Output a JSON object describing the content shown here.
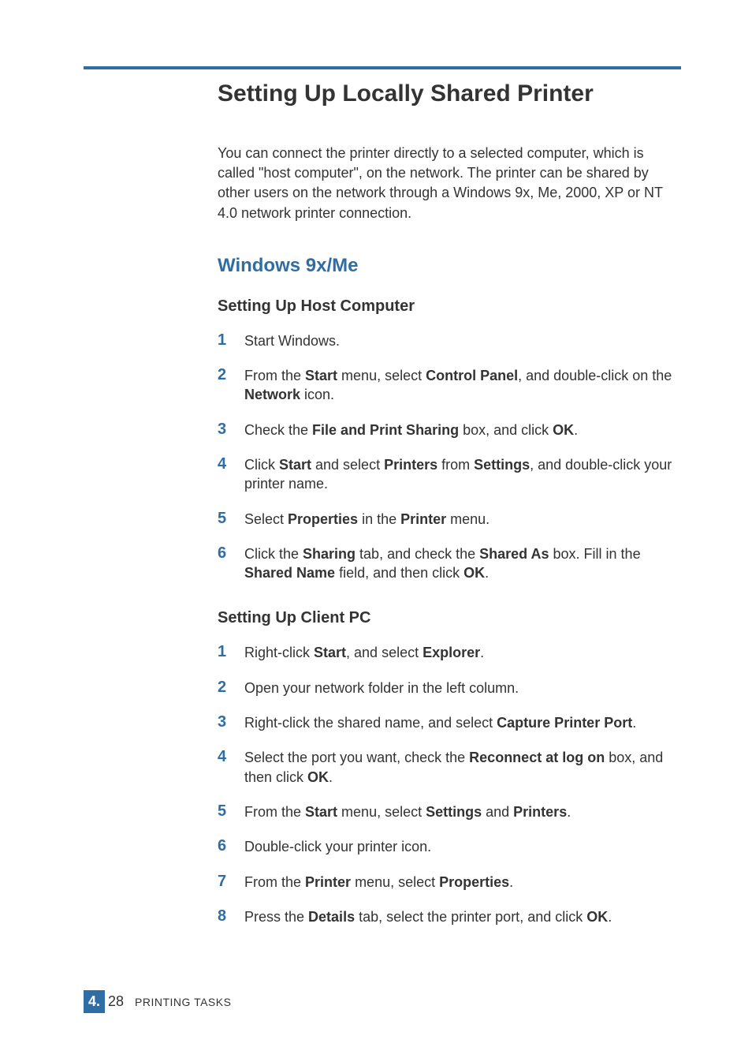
{
  "title": "Setting Up Locally Shared Printer",
  "intro": "You can connect the printer directly to a selected computer, which is called \"host computer\", on the network. The printer can be shared by other users on the network through a Windows  9x, Me, 2000, XP or NT 4.0 network printer connection.",
  "section1": {
    "heading": "Windows 9x/Me"
  },
  "host": {
    "heading": "Setting Up Host Computer",
    "steps": {
      "s1": {
        "num": "1",
        "t1": "Start Windows."
      },
      "s2": {
        "num": "2",
        "t1": "From the ",
        "b1": "Start",
        "t2": " menu, select ",
        "b2": "Control Panel",
        "t3": ", and double-click on the ",
        "b3": "Network",
        "t4": " icon."
      },
      "s3": {
        "num": "3",
        "t1": "Check the ",
        "b1": "File and Print Sharing",
        "t2": " box, and click ",
        "b2": "OK",
        "t3": "."
      },
      "s4": {
        "num": "4",
        "t1": "Click ",
        "b1": "Start",
        "t2": " and select ",
        "b2": "Printers",
        "t3": " from ",
        "b3": "Settings",
        "t4": ", and double-click your printer name."
      },
      "s5": {
        "num": "5",
        "t1": "Select ",
        "b1": "Properties",
        "t2": " in the ",
        "b2": "Printer",
        "t3": " menu."
      },
      "s6": {
        "num": "6",
        "t1": "Click the ",
        "b1": "Sharing",
        "t2": " tab, and check the ",
        "b2": "Shared As",
        "t3": " box. Fill in the ",
        "b3": "Shared Name",
        "t4": " field, and then click ",
        "b4": "OK",
        "t5": "."
      }
    }
  },
  "client": {
    "heading": "Setting Up Client PC",
    "steps": {
      "s1": {
        "num": "1",
        "t1": "Right-click ",
        "b1": "Start",
        "t2": ", and select ",
        "b2": "Explorer",
        "t3": "."
      },
      "s2": {
        "num": "2",
        "t1": "Open your network folder in the left column."
      },
      "s3": {
        "num": "3",
        "t1": "Right-click the shared name, and select ",
        "b1": "Capture Printer Port",
        "t2": "."
      },
      "s4": {
        "num": "4",
        "t1": "Select the port you want, check the ",
        "b1": "Reconnect at log on",
        "t2": " box, and then click ",
        "b2": "OK",
        "t3": "."
      },
      "s5": {
        "num": "5",
        "t1": "From the ",
        "b1": "Start",
        "t2": " menu, select ",
        "b2": "Settings",
        "t3": " and ",
        "b3": "Printers",
        "t4": "."
      },
      "s6": {
        "num": "6",
        "t1": "Double-click your printer icon."
      },
      "s7": {
        "num": "7",
        "t1": "From the ",
        "b1": "Printer",
        "t2": " menu, select ",
        "b2": "Properties",
        "t3": "."
      },
      "s8": {
        "num": "8",
        "t1": "Press the ",
        "b1": "Details",
        "t2": " tab, select the printer port, and click ",
        "b2": "OK",
        "t3": "."
      }
    }
  },
  "footer": {
    "chapter": "4.",
    "page": "28",
    "label": "PRINTING TASKS"
  }
}
